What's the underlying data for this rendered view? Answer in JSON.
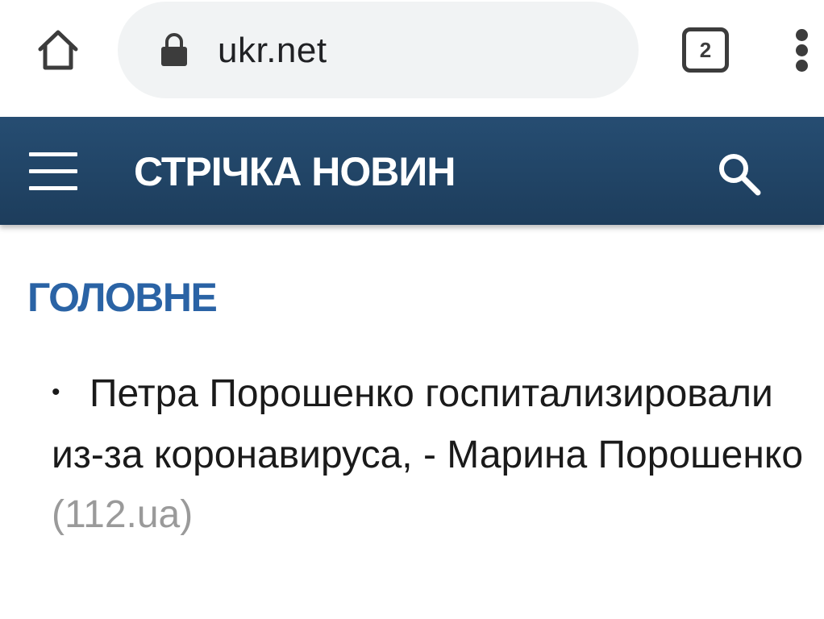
{
  "browser": {
    "url": "ukr.net",
    "tab_count": "2",
    "icons": {
      "home": "home-icon",
      "lock": "lock-icon",
      "tabs": "tabs-icon",
      "menu": "more-vert-icon"
    }
  },
  "header": {
    "title": "СТРІЧКА НОВИН",
    "background_color": "#214669",
    "icons": {
      "menu": "hamburger-menu-icon",
      "search": "search-icon"
    }
  },
  "content": {
    "section_title": "ГОЛОВНЕ",
    "section_title_color": "#2a63a5",
    "news": [
      {
        "bullet": "•",
        "headline": "Петра Порошенко госпитализировали из-за коронавируса, - Марина Порошенко",
        "source": "(112.ua)"
      }
    ]
  }
}
